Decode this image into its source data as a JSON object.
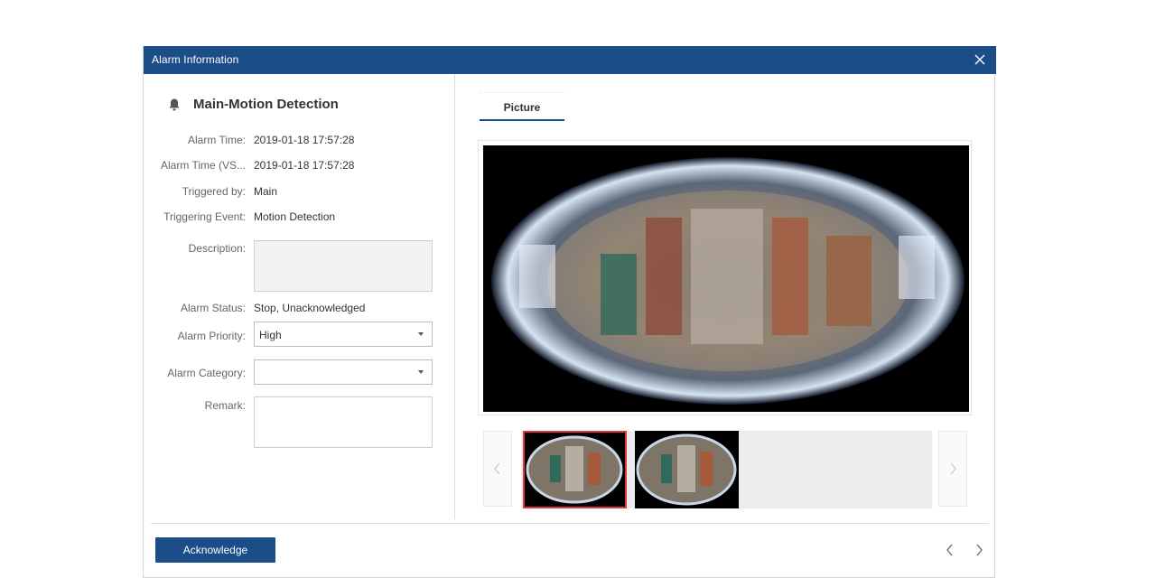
{
  "dialog": {
    "title": "Alarm Information",
    "close_icon": "close-icon"
  },
  "alarm": {
    "heading": "Main-Motion Detection",
    "heading_icon": "bell-icon",
    "fields": [
      {
        "label": "Alarm Time:",
        "value": "2019-01-18 17:57:28"
      },
      {
        "label": "Alarm Time (VS...",
        "value": "2019-01-18 17:57:28"
      },
      {
        "label": "Triggered by:",
        "value": "Main"
      },
      {
        "label": "Triggering Event:",
        "value": "Motion Detection"
      }
    ],
    "description_label": "Description:",
    "description_value": "",
    "status_label": "Alarm Status:",
    "status_value": "Stop, Unacknowledged",
    "priority_label": "Alarm Priority:",
    "priority_value": "High",
    "category_label": "Alarm Category:",
    "category_value": "",
    "remark_label": "Remark:",
    "remark_value": ""
  },
  "media": {
    "tab_label": "Picture",
    "thumbnail_count": 2,
    "selected_thumbnail": 1,
    "prev_icon": "chevron-left-icon",
    "next_icon": "chevron-right-icon"
  },
  "footer": {
    "acknowledge_label": "Acknowledge",
    "prev_alarm_icon": "chevron-left-icon",
    "next_alarm_icon": "chevron-right-icon"
  },
  "colors": {
    "title_bar": "#1b4e89",
    "selected_border": "#e0333d"
  }
}
